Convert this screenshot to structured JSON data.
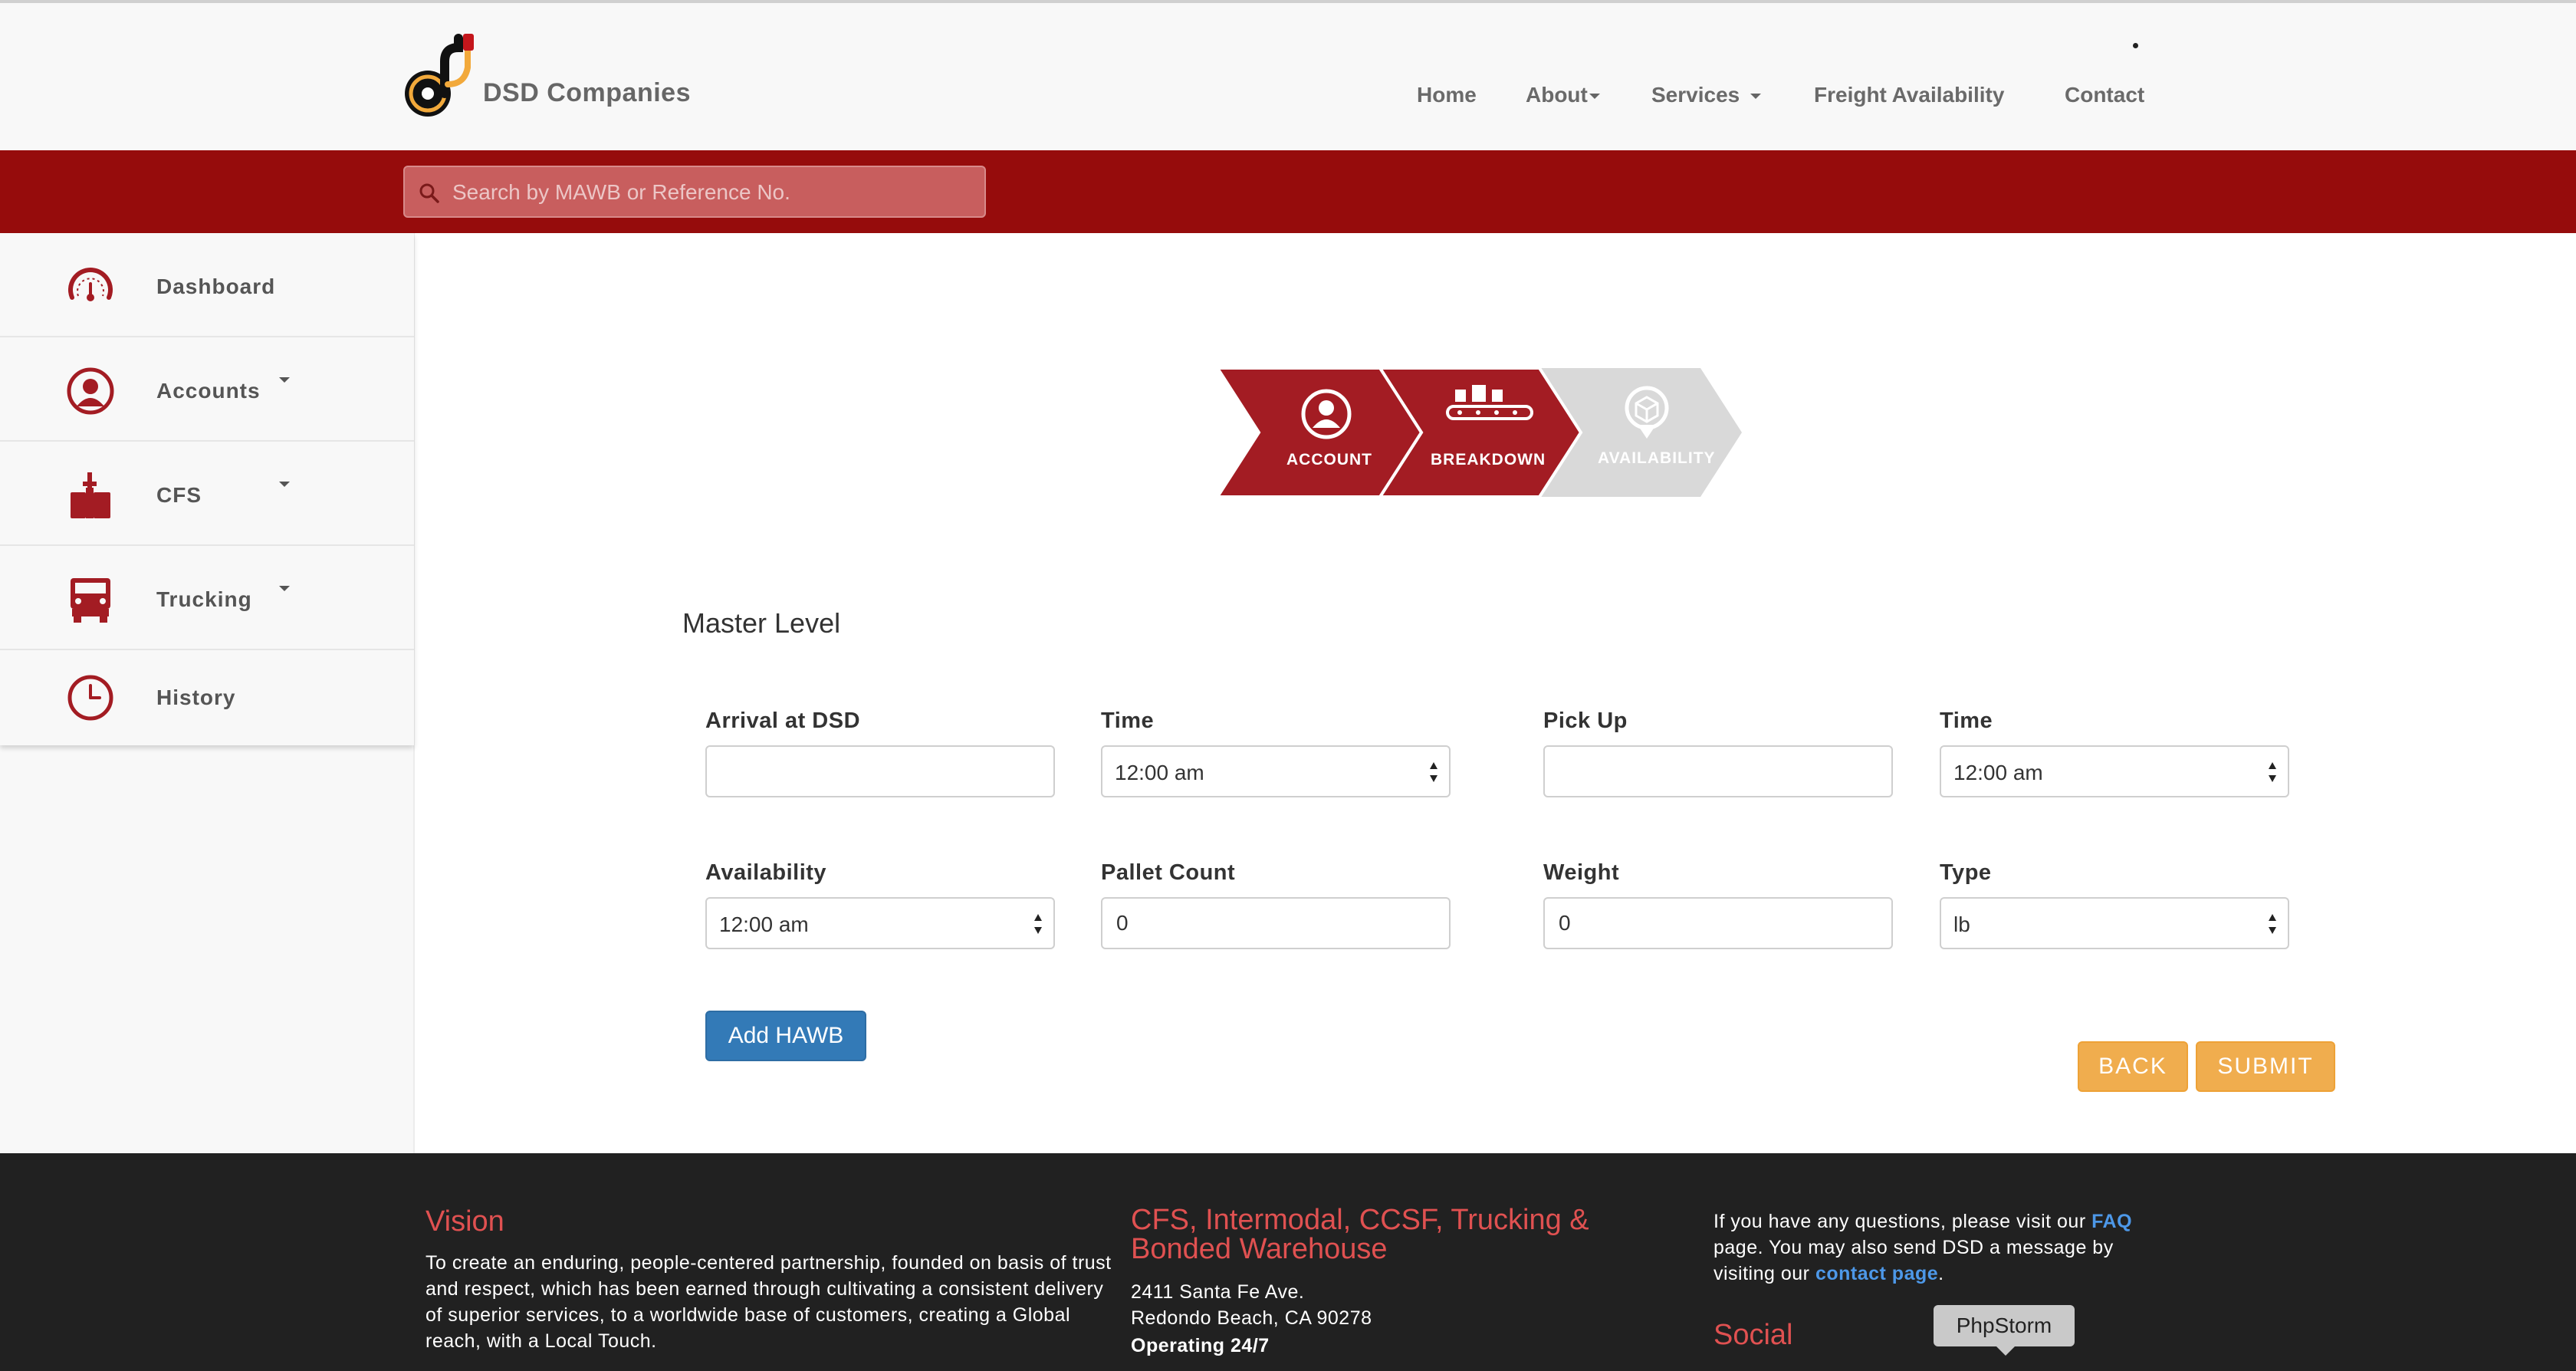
{
  "header": {
    "brand": "DSD Companies",
    "nav": [
      {
        "label": "Home",
        "dropdown": false
      },
      {
        "label": "About",
        "dropdown": true
      },
      {
        "label": "Services",
        "dropdown": true
      },
      {
        "label": "Freight Availability",
        "dropdown": false
      },
      {
        "label": "Contact",
        "dropdown": false
      }
    ]
  },
  "search": {
    "placeholder": "Search by MAWB or Reference No.",
    "icon": "search-icon"
  },
  "sidebar": {
    "items": [
      {
        "label": "Dashboard",
        "icon": "speedometer-icon",
        "dropdown": false
      },
      {
        "label": "Accounts",
        "icon": "user-icon",
        "dropdown": true
      },
      {
        "label": "CFS",
        "icon": "hand-truck-icon",
        "dropdown": true
      },
      {
        "label": "Trucking",
        "icon": "truck-icon",
        "dropdown": true
      },
      {
        "label": "History",
        "icon": "clock-icon",
        "dropdown": false
      }
    ]
  },
  "steps": [
    {
      "label": "ACCOUNT",
      "icon": "user-icon",
      "state": "done"
    },
    {
      "label": "BREAKDOWN",
      "icon": "conveyor-icon",
      "state": "active"
    },
    {
      "label": "AVAILABILITY",
      "icon": "box-pin-icon",
      "state": "inactive"
    }
  ],
  "form": {
    "title": "Master Level",
    "arrival_label": "Arrival at DSD",
    "arrival_value": "",
    "arrival_time_label": "Time",
    "arrival_time_value": "12:00 am",
    "pickup_label": "Pick Up",
    "pickup_value": "",
    "pickup_time_label": "Time",
    "pickup_time_value": "12:00 am",
    "availability_label": "Availability",
    "availability_value": "12:00 am",
    "pallet_label": "Pallet Count",
    "pallet_value": "0",
    "weight_label": "Weight",
    "weight_value": "0",
    "type_label": "Type",
    "type_value": "lb",
    "add_hawb_label": "Add HAWB",
    "back_label": "BACK",
    "submit_label": "SUBMIT"
  },
  "footer": {
    "vision_title": "Vision",
    "vision_text": "To create an enduring, people-centered partnership, founded on basis of trust and respect, which has been earned through cultivating a consistent delivery of superior services, to a worldwide base of customers, creating a Global reach, with a Local Touch.",
    "services_title": "CFS, Intermodal, CCSF, Trucking & Bonded Warehouse",
    "address_line1": "2411 Santa Fe Ave.",
    "address_line2": "Redondo Beach, CA 90278",
    "hours": "Operating 24/7",
    "questions_pre": "If you have any questions, please visit our",
    "faq_link": "FAQ",
    "questions_mid": "page. You may also send DSD a message by visiting our",
    "contact_link": "contact page",
    "questions_end": ".",
    "social_title": "Social"
  },
  "tooltip": "PhpStorm",
  "colors": {
    "brand_red": "#960c0c",
    "step_red": "#a31c23",
    "step_inactive": "#d9d9d9",
    "primary_blue": "#337ab7",
    "warning_orange": "#f0ad4e",
    "footer_bg": "#212121",
    "footer_heading": "#e05151"
  }
}
